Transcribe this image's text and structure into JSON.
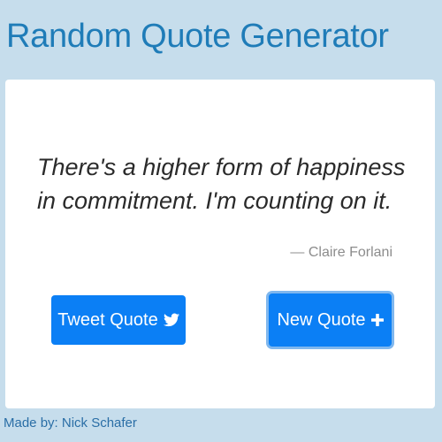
{
  "app": {
    "title": "Random Quote Generator"
  },
  "quote": {
    "text": "There's a higher form of happiness in commitment. I'm counting on it.",
    "author": "— Claire Forlani"
  },
  "buttons": {
    "tweet_label": "Tweet Quote",
    "tweet_icon": "twitter-icon",
    "new_label": "New Quote",
    "new_icon": "plus-icon"
  },
  "footer": {
    "credit": "Made by: Nick Schafer"
  },
  "colors": {
    "background": "#c6ddec",
    "title": "#1f7cb8",
    "button": "#0b7ff5",
    "author": "#8c8c8c"
  }
}
